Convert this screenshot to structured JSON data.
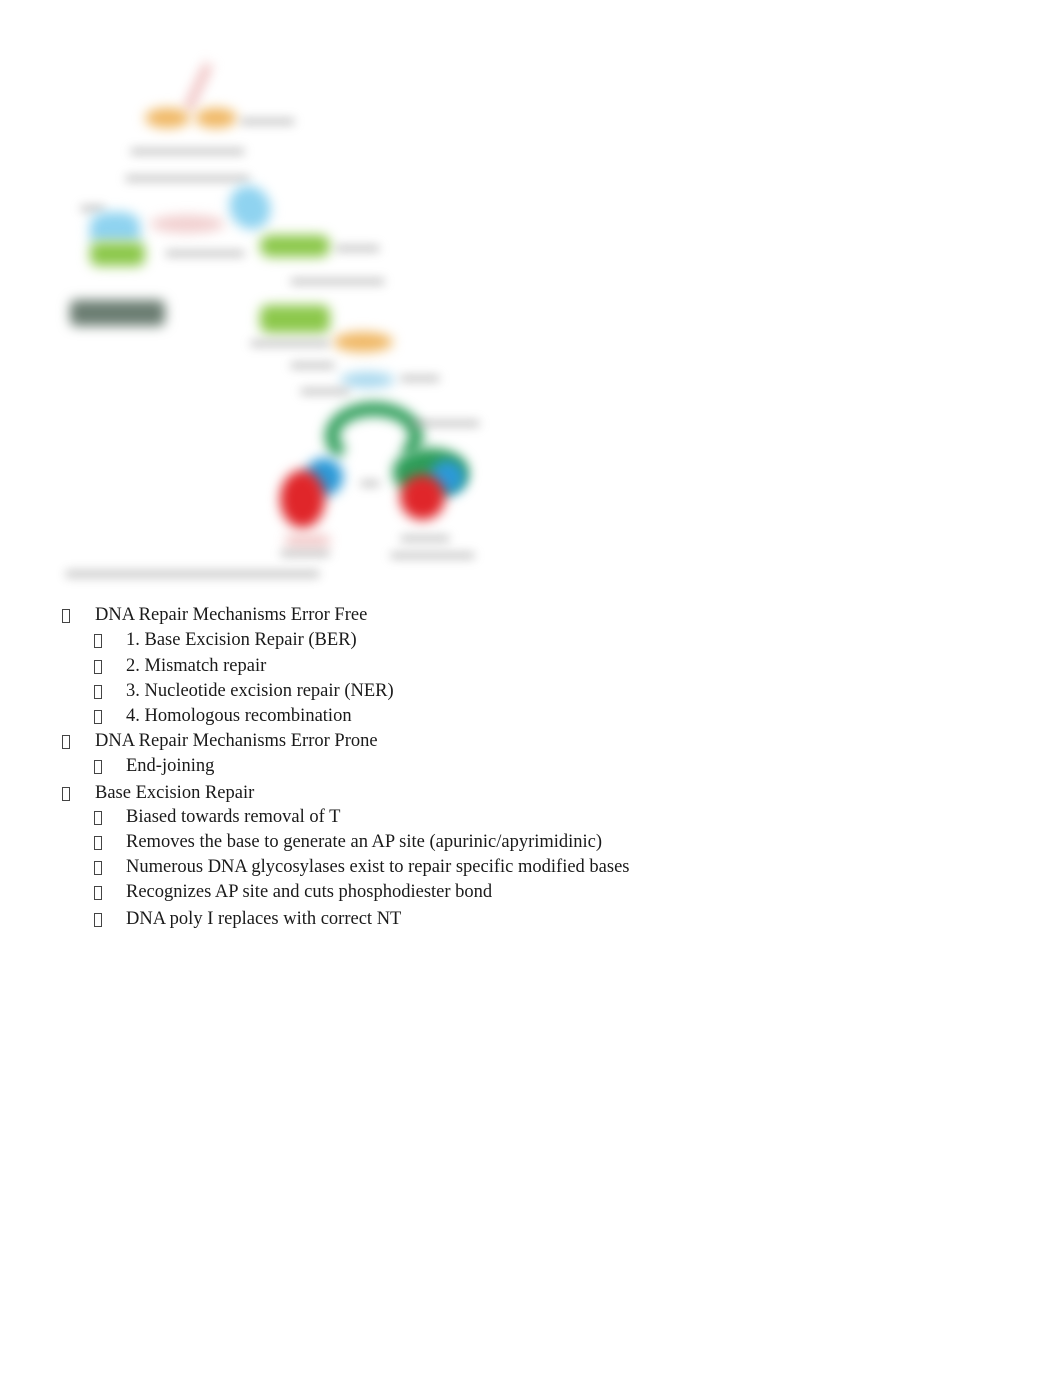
{
  "figure": {
    "description": "blurred diagram of DNA repair pathways",
    "caption": ""
  },
  "outline": [
    {
      "level": 1,
      "text": "DNA Repair Mechanisms Error Free"
    },
    {
      "level": 2,
      "text": "1. Base Excision Repair (BER)"
    },
    {
      "level": 2,
      "text": "2. Mismatch repair"
    },
    {
      "level": 2,
      "text": "3. Nucleotide excision repair (NER)"
    },
    {
      "level": 2,
      "text": "4. Homologous recombination"
    },
    {
      "level": 1,
      "text": "DNA Repair Mechanisms Error Prone"
    },
    {
      "level": 2,
      "text": "End-joining"
    },
    {
      "level": 1,
      "text": "Base Excision Repair"
    },
    {
      "level": 2,
      "text": "Biased towards removal of T"
    },
    {
      "level": 2,
      "text": "Removes the base to generate an AP site (apurinic/apyrimidinic)"
    },
    {
      "level": 2,
      "text": "Numerous DNA glycosylases exist to repair specific modified bases"
    },
    {
      "level": 2,
      "text": "Recognizes AP site and cuts phosphodiester bond"
    },
    {
      "level": 2,
      "text": "DNA poly I replaces with correct NT"
    }
  ],
  "bullet_icon": "missing-glyph-box",
  "colors": {
    "orange": "#f0b865",
    "light_blue": "#8fd3f0",
    "green": "#8cc84b",
    "dark_gray": "#6b7d72",
    "dark_green": "#2e9e5a",
    "red": "#e0262a",
    "blue": "#2c9ad8",
    "pink": "#e8a0a0"
  }
}
